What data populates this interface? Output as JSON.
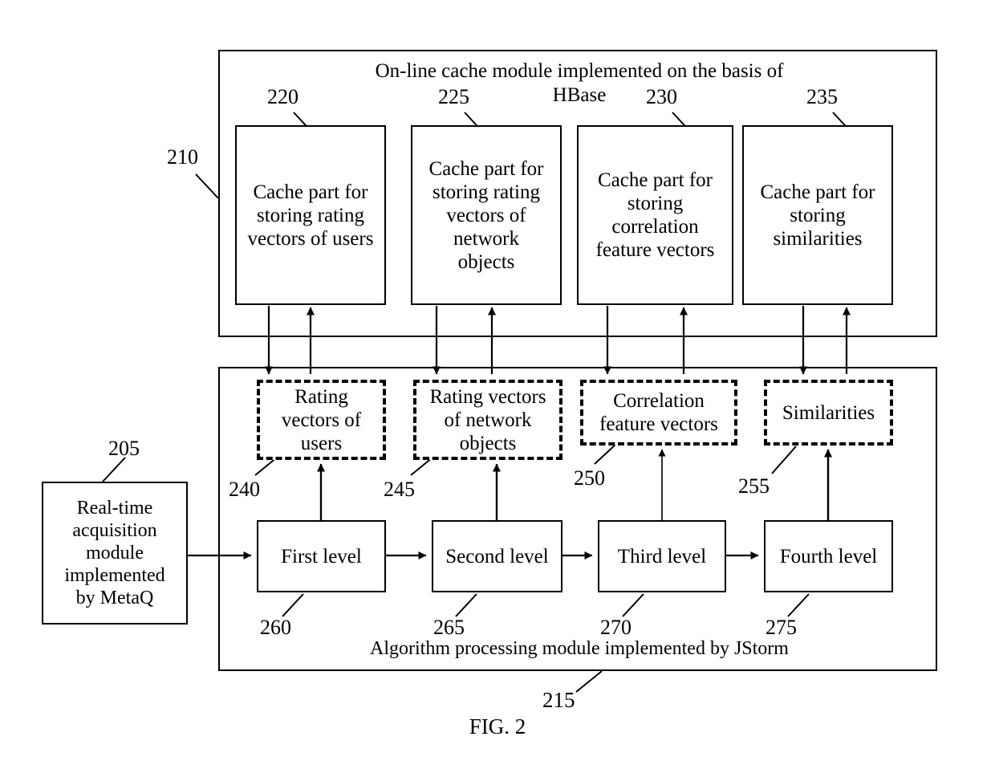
{
  "figure": {
    "caption": "FIG. 2"
  },
  "cache_module": {
    "ref": "210",
    "title": "On-line cache module implemented on the basis of\nHBase",
    "parts": [
      {
        "ref": "220",
        "label": "Cache part for\nstoring rating\nvectors of users"
      },
      {
        "ref": "225",
        "label": "Cache part for\nstoring rating\nvectors of\nnetwork\nobjects"
      },
      {
        "ref": "230",
        "label": "Cache part for\nstoring\ncorrelation\nfeature vectors"
      },
      {
        "ref": "235",
        "label": "Cache part for\nstoring\nsimilarities"
      }
    ]
  },
  "algorithm_module": {
    "ref": "215",
    "title": "Algorithm processing module implemented by JStorm",
    "data_items": [
      {
        "ref": "240",
        "label": "Rating\nvectors of\nusers"
      },
      {
        "ref": "245",
        "label": "Rating vectors\nof network\nobjects"
      },
      {
        "ref": "250",
        "label": "Correlation\nfeature vectors"
      },
      {
        "ref": "255",
        "label": "Similarities"
      }
    ],
    "levels": [
      {
        "ref": "260",
        "label": "First level"
      },
      {
        "ref": "265",
        "label": "Second level"
      },
      {
        "ref": "270",
        "label": "Third level"
      },
      {
        "ref": "275",
        "label": "Fourth level"
      }
    ]
  },
  "acquisition_module": {
    "ref": "205",
    "label": "Real-time\nacquisition\nmodule\nimplemented\nby MetaQ"
  },
  "colors": {
    "stroke": "#000000",
    "background": "#ffffff"
  }
}
